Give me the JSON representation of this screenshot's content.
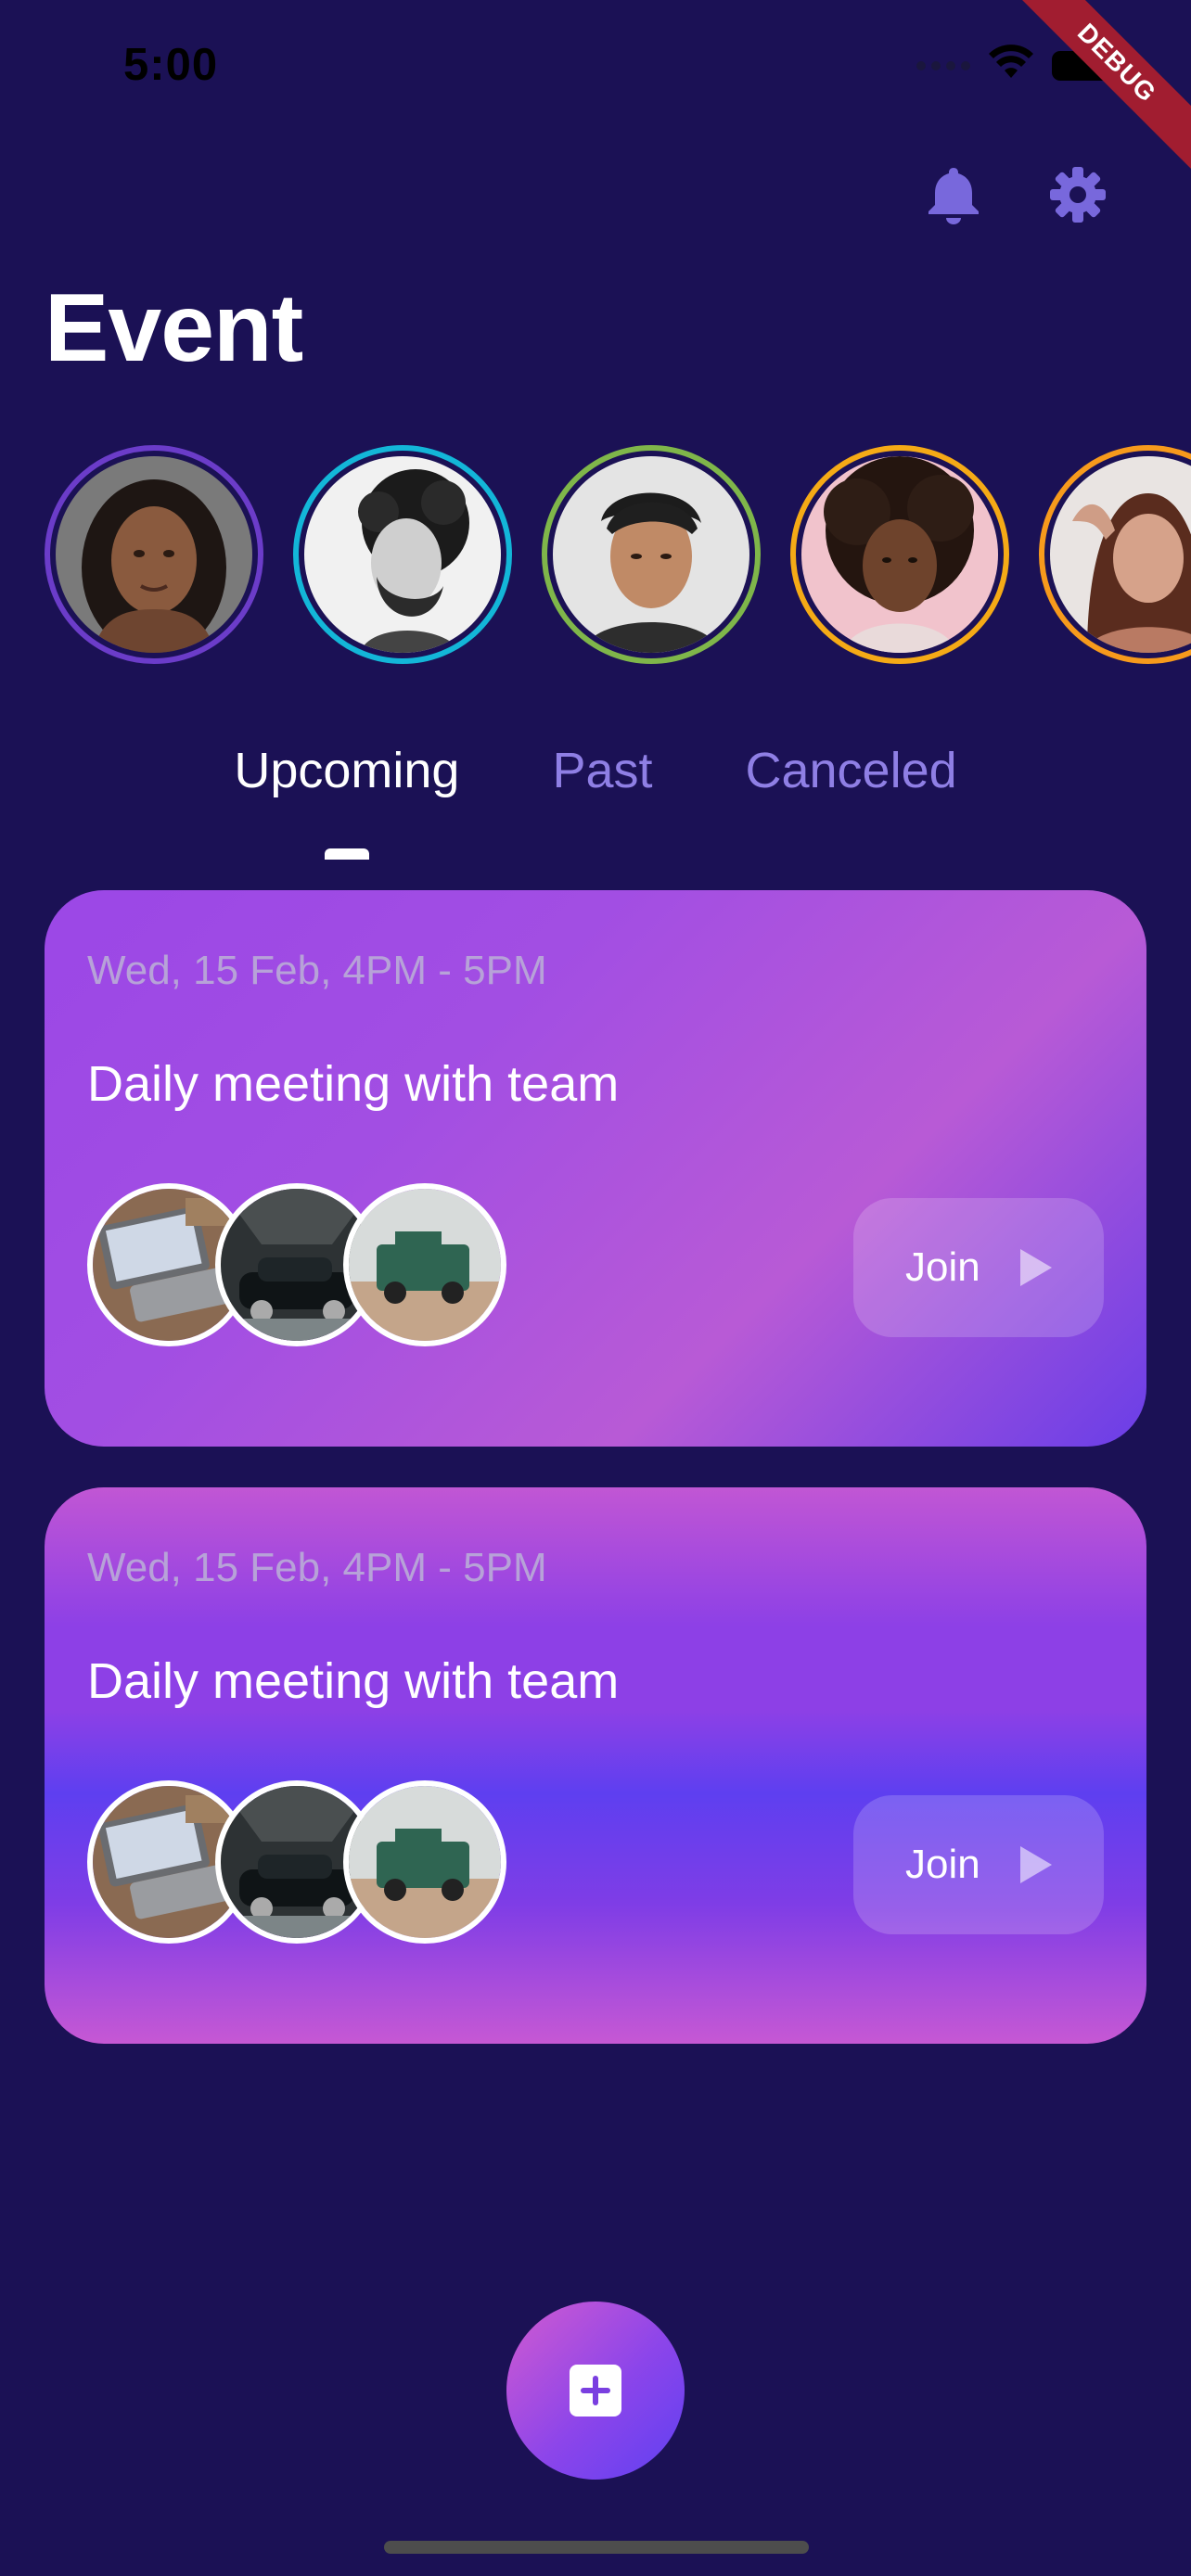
{
  "status_bar": {
    "time": "5:00",
    "debug_label": "DEBUG"
  },
  "header": {
    "title": "Event",
    "icons": [
      "bell-icon",
      "gear-icon"
    ]
  },
  "stories": [
    {
      "ring_color": "#6b3cc9"
    },
    {
      "ring_color": "#13b6d8"
    },
    {
      "ring_color": "#7fb64a"
    },
    {
      "ring_color": "#f5aa16"
    },
    {
      "ring_color": "#f79a1c"
    }
  ],
  "tabs": [
    {
      "label": "Upcoming",
      "active": true
    },
    {
      "label": "Past",
      "active": false
    },
    {
      "label": "Canceled",
      "active": false
    }
  ],
  "events": [
    {
      "date": "Wed, 15 Feb, 4PM - 5PM",
      "title": "Daily meeting with team",
      "join_label": "Join"
    },
    {
      "date": "Wed, 15 Feb, 4PM - 5PM",
      "title": "Daily meeting with team",
      "join_label": "Join"
    }
  ],
  "colors": {
    "background": "#1b1155",
    "accent": "#7c6be0",
    "tab_inactive": "#8f7fe5"
  },
  "fab": {
    "icon": "plus-square-icon"
  }
}
